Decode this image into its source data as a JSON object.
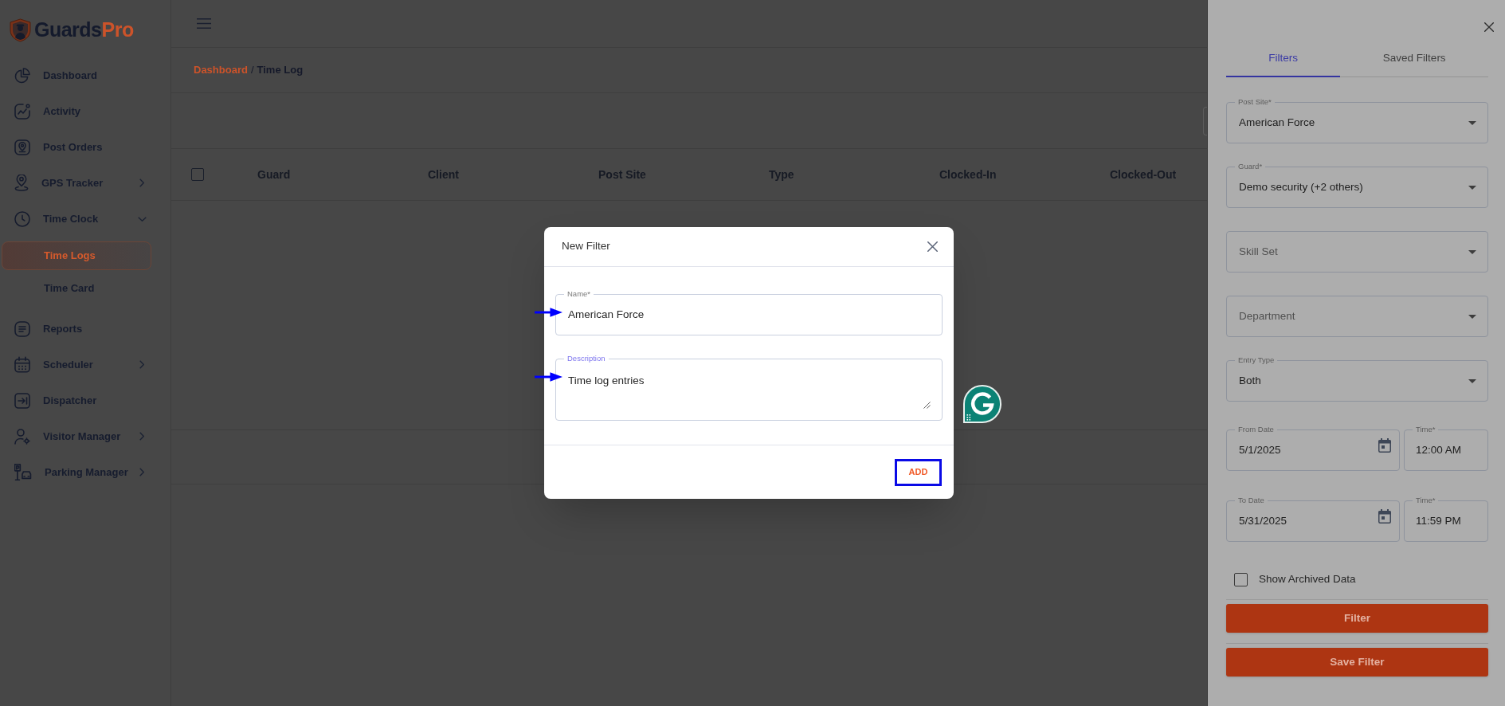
{
  "sidebar": {
    "brand": {
      "main": "Guards",
      "accent": "Pro"
    },
    "items": [
      {
        "label": "Dashboard",
        "selected": false
      },
      {
        "label": "Activity",
        "selected": false
      },
      {
        "label": "Post Orders",
        "selected": false
      },
      {
        "label": "GPS Tracker",
        "selected": false,
        "expanded": false
      },
      {
        "label": "Time Clock",
        "selected": false,
        "expanded": true,
        "children": [
          {
            "label": "Time Logs",
            "selected": true
          },
          {
            "label": "Time Card",
            "selected": false
          }
        ]
      },
      {
        "label": "Reports",
        "selected": false
      },
      {
        "label": "Scheduler",
        "selected": false,
        "expanded": false
      },
      {
        "label": "Dispatcher",
        "selected": false
      },
      {
        "label": "Visitor Manager",
        "selected": false,
        "expanded": false
      },
      {
        "label": "Parking Manager",
        "selected": false,
        "expanded": false
      }
    ]
  },
  "breadcrumb": {
    "items": [
      {
        "label": "Dashboard",
        "kind": "link"
      },
      {
        "label": "Time Log",
        "kind": "current"
      }
    ],
    "separator": "/"
  },
  "table": {
    "header_checkbox": {
      "checked": false
    },
    "columns": [
      "Guard",
      "Client",
      "Post Site",
      "Type",
      "Clocked-In",
      "Clocked-Out"
    ]
  },
  "modal": {
    "title": "New Filter",
    "fields": [
      {
        "kind": "input",
        "label": "Name*",
        "value": "American Force",
        "focused": false,
        "marked": true
      },
      {
        "kind": "textarea",
        "label": "Description",
        "value": "Time log entries",
        "focused": true,
        "marked": true
      }
    ],
    "buttons": [
      {
        "label": "ADD",
        "highlighted": true
      }
    ]
  },
  "drawer": {
    "tabs": [
      {
        "label": "Filters",
        "selected": true
      },
      {
        "label": "Saved Filters",
        "selected": false
      }
    ],
    "selects": [
      {
        "label": "Post Site*",
        "value": "American Force"
      },
      {
        "label": "Guard*",
        "value": "Demo security (+2 others)"
      },
      {
        "placeholder": "Skill Set"
      },
      {
        "placeholder": "Department"
      },
      {
        "label": "Entry Type",
        "value": "Both"
      }
    ],
    "date_ranges": [
      {
        "date_label": "From Date",
        "date": "5/1/2025",
        "time_label": "Time*",
        "time": "12:00 AM"
      },
      {
        "date_label": "To Date",
        "date": "5/31/2025",
        "time_label": "Time*",
        "time": "11:59 PM"
      }
    ],
    "archived": {
      "label": "Show Archived Data",
      "checked": false
    },
    "buttons": [
      {
        "label": "Filter"
      },
      {
        "label": "Save Filter"
      }
    ]
  }
}
